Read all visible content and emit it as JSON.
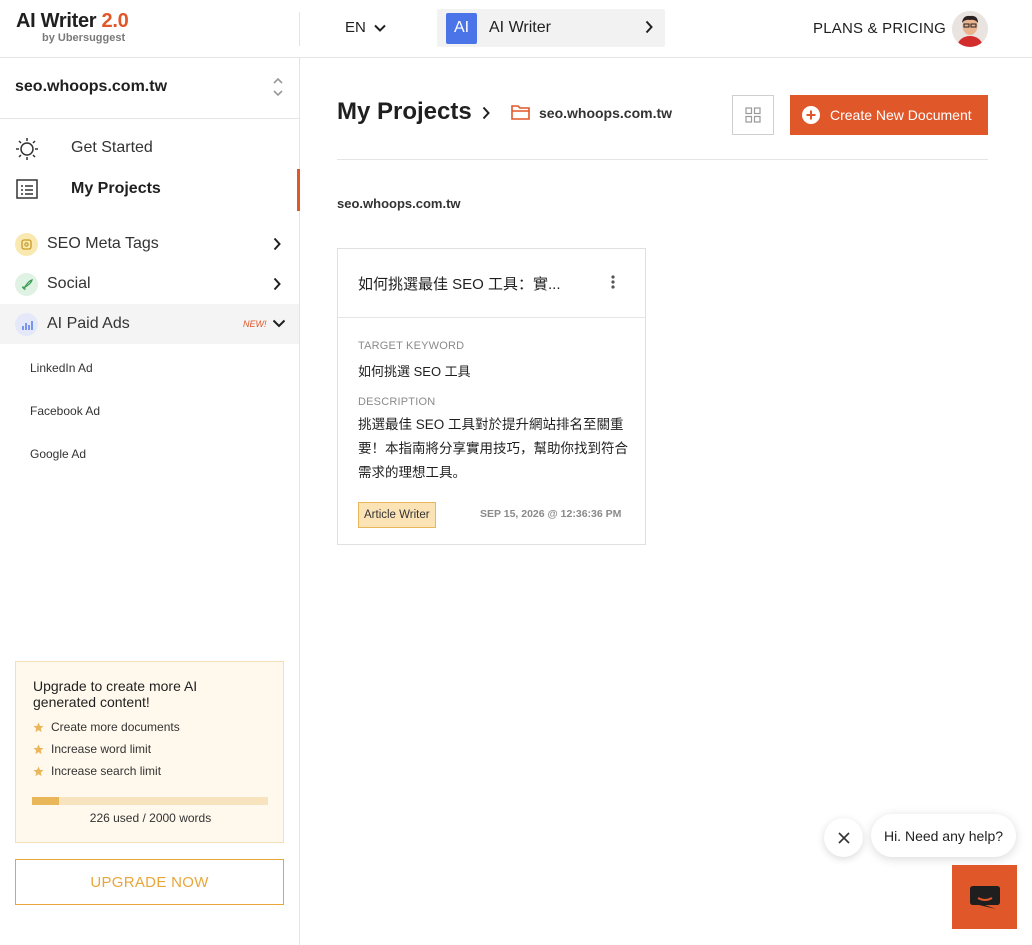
{
  "header": {
    "logo_title": "AI Writer ",
    "logo_version": "2.0",
    "logo_sub": "by Ubersuggest",
    "language": "EN",
    "tool_badge": "AI",
    "tool_name": "AI Writer",
    "plans_label": "PLANS & PRICING"
  },
  "sidebar": {
    "site": "seo.whoops.com.tw",
    "nav": [
      {
        "label": "Get Started",
        "icon": "sun-icon"
      },
      {
        "label": "My Projects",
        "icon": "list-icon",
        "active": true
      }
    ],
    "features": [
      {
        "label": "SEO Meta Tags",
        "icon": "tag-icon",
        "color": "#f9e9b0"
      },
      {
        "label": "Social",
        "icon": "rocket-icon",
        "color": "#dff2e3"
      },
      {
        "label": "AI Paid Ads",
        "icon": "chart-icon",
        "color": "#e4e8f9",
        "badge": "NEW!",
        "expanded": true
      }
    ],
    "sub_items": [
      "LinkedIn Ad",
      "Facebook Ad",
      "Google Ad"
    ],
    "upgrade": {
      "title": "Upgrade to create more AI generated content!",
      "perks": [
        "Create more documents",
        "Increase word limit",
        "Increase search limit"
      ],
      "used_fraction": 0.113,
      "usage_text": "226 used / 2000 words",
      "button": "UPGRADE NOW"
    }
  },
  "main": {
    "title": "My Projects",
    "breadcrumb_site": "seo.whoops.com.tw",
    "create_button": "Create New Document",
    "section_label": "seo.whoops.com.tw",
    "card": {
      "title": "如何挑選最佳 SEO 工具：實...",
      "keyword_label": "TARGET KEYWORD",
      "keyword": "如何挑選 SEO 工具",
      "description_label": "DESCRIPTION",
      "description": "挑選最佳 SEO 工具對於提升網站排名至關重要！本指南將分享實用技巧，幫助你找到符合需求的理想工具。",
      "tag": "Article Writer",
      "date": "SEP 15, 2026 @ 12:36:36 PM"
    }
  },
  "chat": {
    "greeting": "Hi. Need any help?"
  },
  "colors": {
    "accent": "#e0572a",
    "upgrade_gold": "#e8a63a",
    "tool_blue": "#4a74e8"
  }
}
